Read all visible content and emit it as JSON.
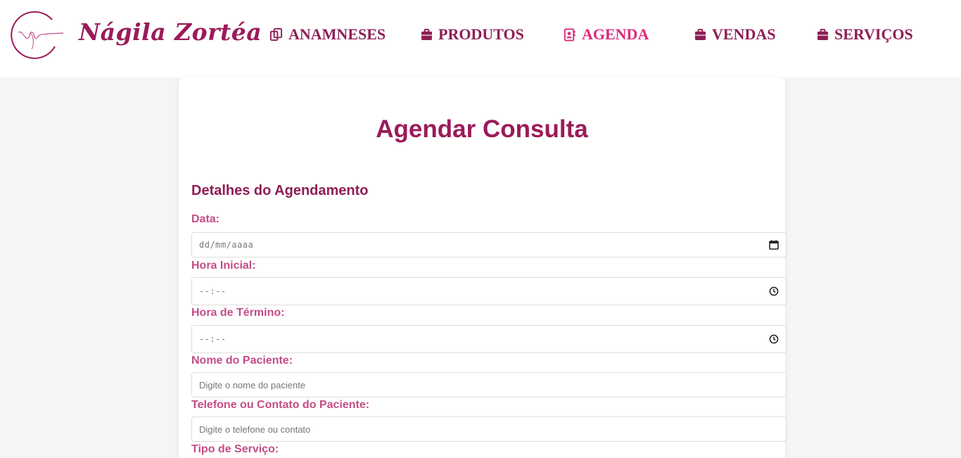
{
  "brand": {
    "name": "Nágila Zortéa",
    "colors": {
      "primary": "#9b1b5a",
      "accent": "#e0287a",
      "label": "#c24d85",
      "background": "#f5f5f5"
    }
  },
  "nav": {
    "items": [
      {
        "label": "ANAMNESES",
        "icon": "copy-icon",
        "active": false
      },
      {
        "label": "PRODUTOS",
        "icon": "briefcase-icon",
        "active": false
      },
      {
        "label": "AGENDA",
        "icon": "contact-book-icon",
        "active": true
      },
      {
        "label": "VENDAS",
        "icon": "briefcase-icon",
        "active": false
      },
      {
        "label": "SERVIÇOS",
        "icon": "briefcase-icon",
        "active": false
      }
    ]
  },
  "form": {
    "title": "Agendar Consulta",
    "section_title": "Detalhes do Agendamento",
    "fields": {
      "date": {
        "label": "Data:",
        "placeholder": "dd/mm/aaaa",
        "icon": "calendar-icon"
      },
      "start_time": {
        "label": "Hora Inicial:",
        "placeholder": "--:--",
        "icon": "clock-icon"
      },
      "end_time": {
        "label": "Hora de Término:",
        "placeholder": "--:--",
        "icon": "clock-icon"
      },
      "patient_name": {
        "label": "Nome do Paciente:",
        "placeholder": "Digite o nome do paciente"
      },
      "patient_contact": {
        "label": "Telefone ou Contato do Paciente:",
        "placeholder": "Digite o telefone ou contato"
      },
      "service_type": {
        "label": "Tipo de Serviço:"
      }
    }
  }
}
